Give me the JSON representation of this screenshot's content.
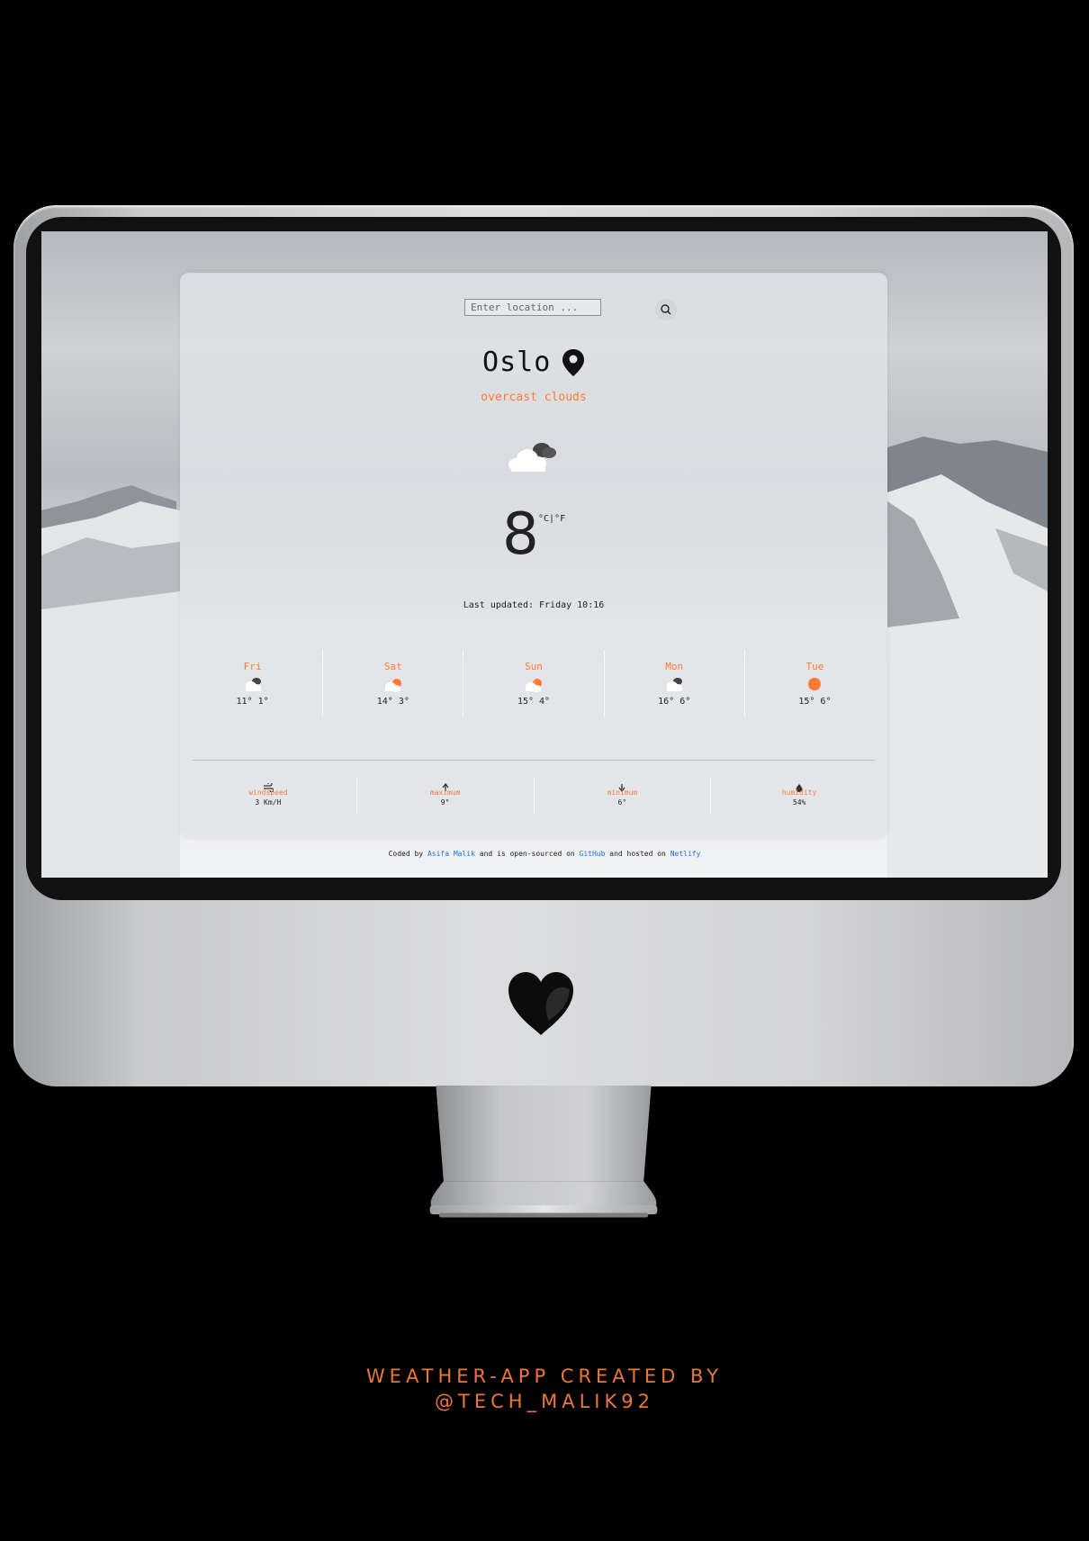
{
  "app": {
    "search": {
      "placeholder": "Enter location ..."
    },
    "city": "Oslo",
    "description": "overcast clouds",
    "temperature": "8",
    "units": "°C|°F",
    "last_updated": "Last updated: Friday 10:16",
    "forecast": [
      {
        "day": "Fri",
        "temps": "11° 1°",
        "icon": "cloudy-icon"
      },
      {
        "day": "Sat",
        "temps": "14° 3°",
        "icon": "partly-cloudy-icon"
      },
      {
        "day": "Sun",
        "temps": "15° 4°",
        "icon": "partly-cloudy-icon"
      },
      {
        "day": "Mon",
        "temps": "16° 6°",
        "icon": "cloudy-icon"
      },
      {
        "day": "Tue",
        "temps": "15° 6°",
        "icon": "sun-icon"
      }
    ],
    "stats": [
      {
        "label": "windspeed",
        "value": "3 Km/H",
        "icon": "wind-icon"
      },
      {
        "label": "maximum",
        "value": "9°",
        "icon": "arrow-up-icon"
      },
      {
        "label": "minimum",
        "value": "6°",
        "icon": "arrow-down-icon"
      },
      {
        "label": "humidity",
        "value": "54%",
        "icon": "droplet-icon"
      }
    ],
    "footer": {
      "t1": "Coded by ",
      "author": "Asifa Malik",
      "t2": " and is open-sourced on ",
      "github": "GitHub",
      "t3": " and hosted on ",
      "netlify": "Netlify"
    }
  },
  "caption": {
    "line1": "WEATHER-APP CREATED BY",
    "line2": "@TECH_MALIK92"
  },
  "colors": {
    "accent": "#ff7a33",
    "link": "#1e73e8",
    "caption": "#e8773c"
  }
}
